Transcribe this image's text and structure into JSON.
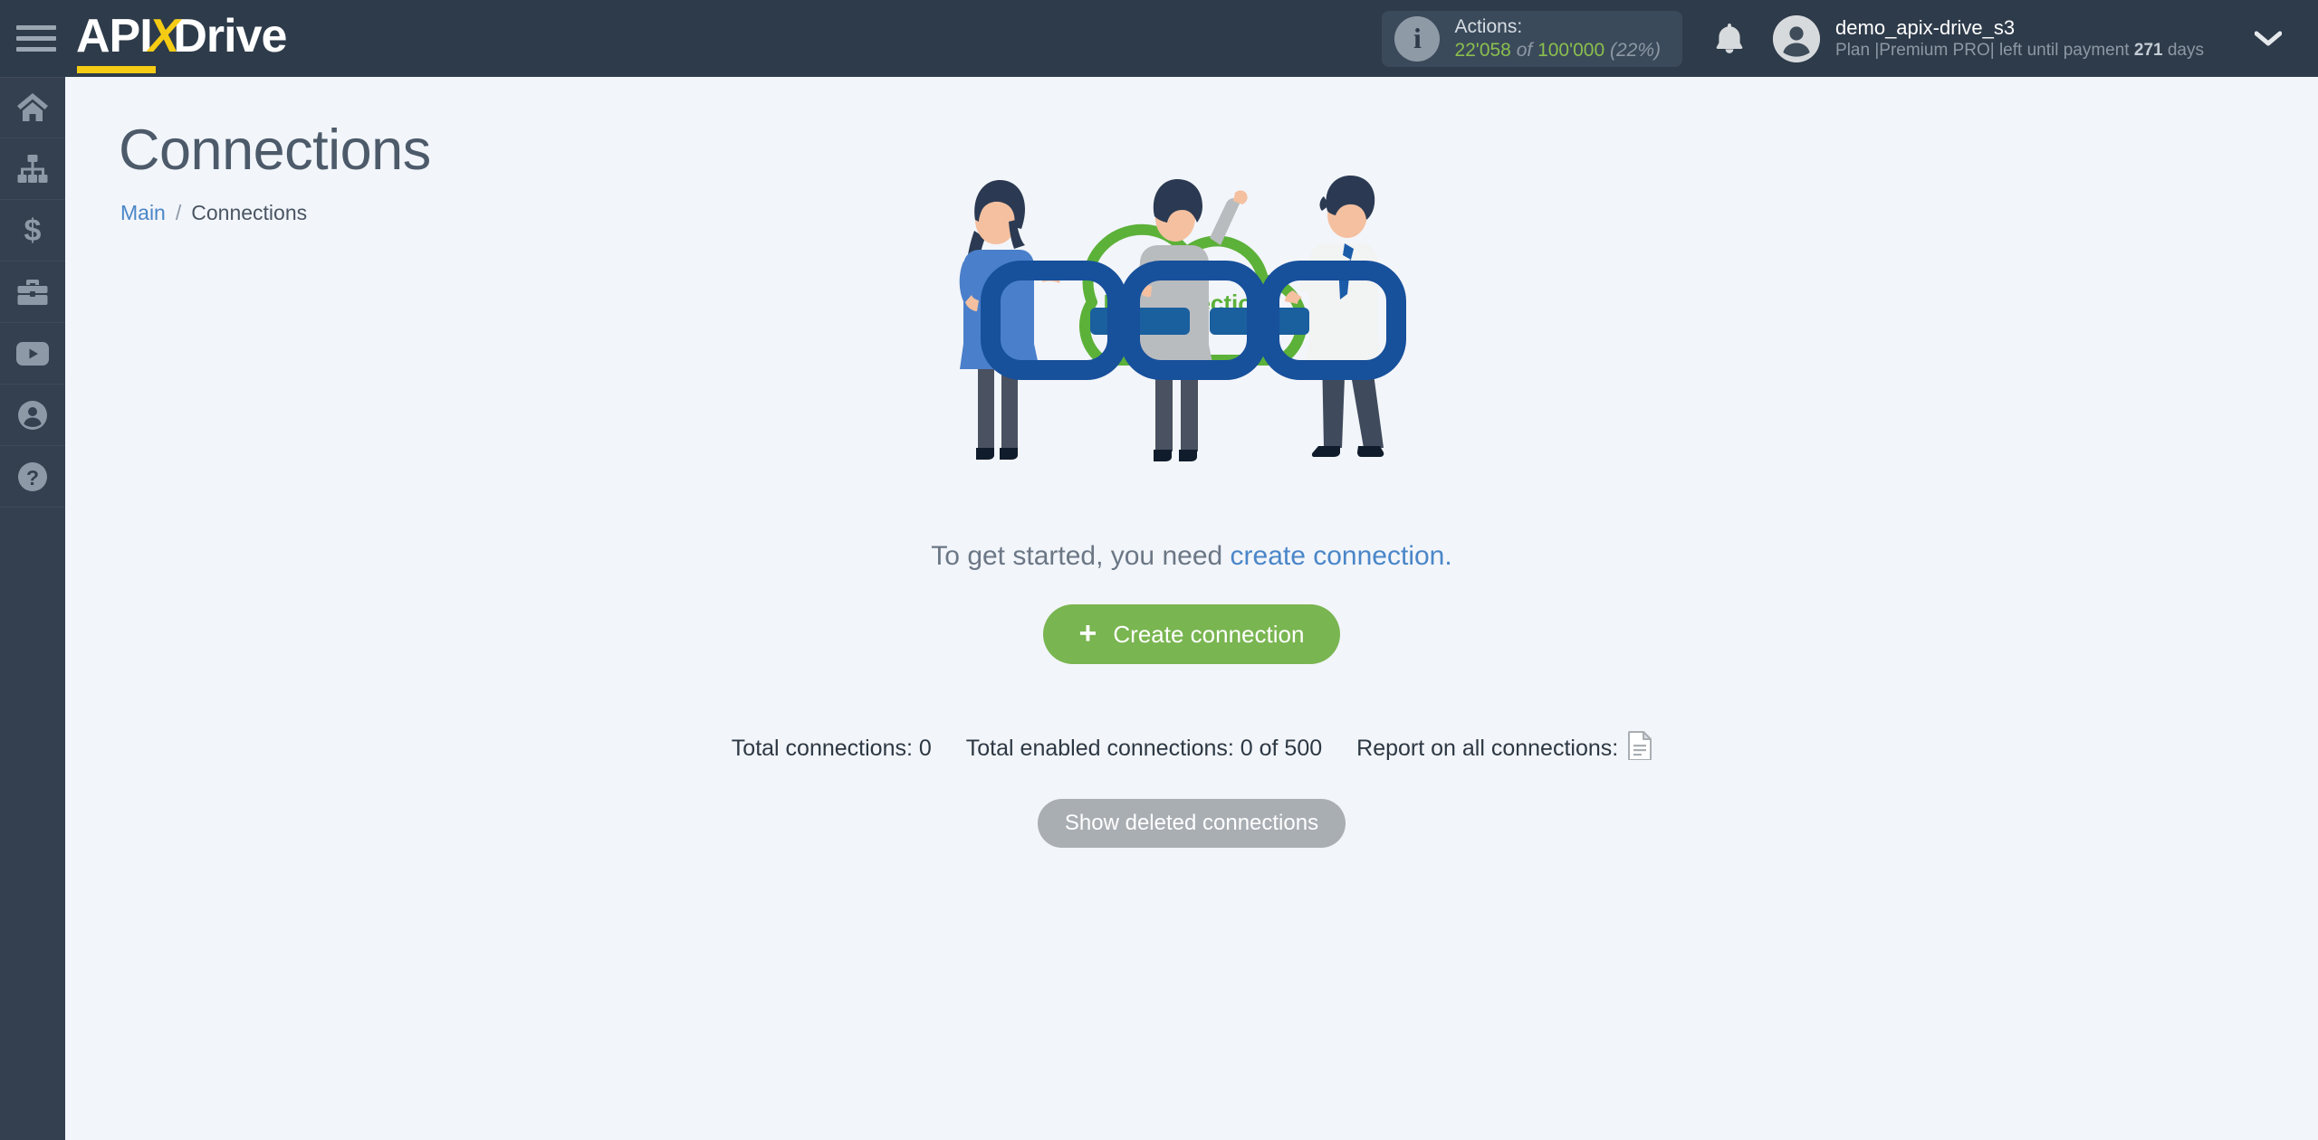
{
  "brand": {
    "logo_part1": "API",
    "logo_x": "X",
    "logo_part2": "Drive"
  },
  "topbar": {
    "menu_icon": "hamburger-icon",
    "actions": {
      "info_icon": "info-icon",
      "label": "Actions:",
      "used": "22'058",
      "of": "of",
      "total": "100'000",
      "percent": "(22%)"
    },
    "notifications_icon": "bell-icon",
    "user": {
      "avatar_icon": "user-avatar-icon",
      "name": "demo_apix-drive_s3",
      "plan_prefix": "Plan |Premium PRO| left until payment",
      "days_value": "271",
      "days_suffix": "days"
    },
    "dropdown_icon": "chevron-down-icon"
  },
  "sidebar": {
    "items": [
      {
        "icon": "home-icon",
        "label": "Main"
      },
      {
        "icon": "connections-icon",
        "label": "Connections"
      },
      {
        "icon": "dollar-icon",
        "label": "Payments"
      },
      {
        "icon": "briefcase-icon",
        "label": "Business"
      },
      {
        "icon": "youtube-icon",
        "label": "Video"
      },
      {
        "icon": "user-icon",
        "label": "Profile"
      },
      {
        "icon": "help-icon",
        "label": "Help"
      }
    ]
  },
  "page": {
    "title": "Connections",
    "breadcrumb": {
      "home": "Main",
      "separator": "/",
      "current": "Connections"
    }
  },
  "empty_state": {
    "cloud_label": "No connections",
    "hint_prefix": "To get started, you need ",
    "hint_link": "create connection.",
    "create_button": {
      "icon": "plus-icon",
      "label": "Create connection"
    }
  },
  "stats": {
    "total_connections": "Total connections: 0",
    "total_enabled": "Total enabled connections: 0 of 500",
    "report_label": "Report on all connections:",
    "report_icon": "document-icon"
  },
  "deleted_button": {
    "label": "Show deleted connections"
  },
  "colors": {
    "topbar_bg": "#2e3b4a",
    "sidebar_bg": "#344050",
    "page_bg": "#f2f5fa",
    "accent_green": "#79b550",
    "accent_yellow": "#f5cc13",
    "link_blue": "#4a86c8",
    "muted_gray": "#a9aeb3",
    "cloud_green": "#5cb139",
    "chain_blue": "#17509b"
  }
}
